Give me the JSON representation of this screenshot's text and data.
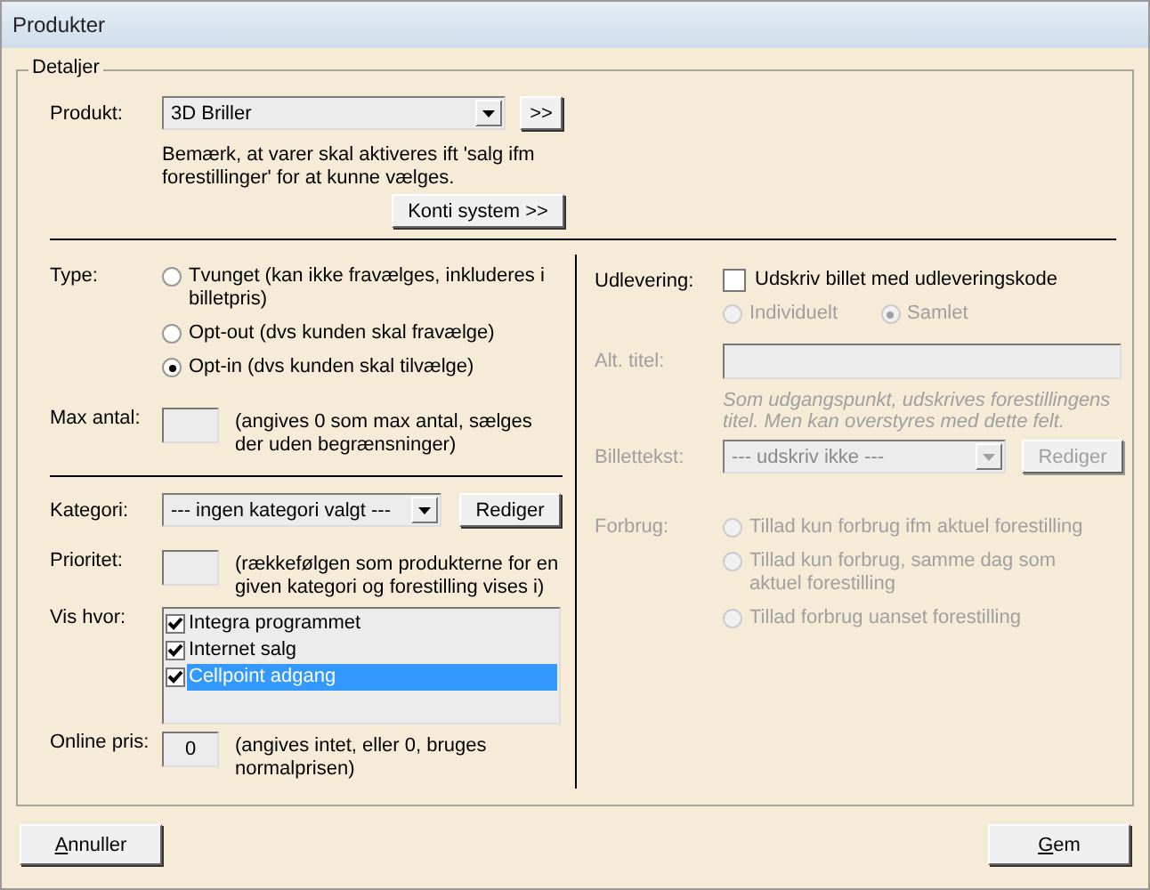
{
  "window": {
    "title": "Produkter"
  },
  "group": {
    "title": "Detaljer"
  },
  "product": {
    "label": "Produkt:",
    "value": "3D Briller",
    "more_button": ">>",
    "note": "Bemærk, at varer skal aktiveres ift 'salg ifm forestillinger' for at kunne vælges.",
    "konti_button": "Konti system >>"
  },
  "type": {
    "label": "Type:",
    "options": [
      {
        "label": "Tvunget (kan ikke fravælges, inkluderes i billetpris)",
        "selected": false
      },
      {
        "label": "Opt-out (dvs kunden skal fravælge)",
        "selected": false
      },
      {
        "label": "Opt-in (dvs kunden skal tilvælge)",
        "selected": true
      }
    ]
  },
  "max_antal": {
    "label": "Max antal:",
    "hint": "(angives 0 som max antal, sælges der uden begrænsninger)"
  },
  "kategori": {
    "label": "Kategori:",
    "value": "--- ingen kategori valgt ---",
    "button": "Rediger"
  },
  "prioritet": {
    "label": "Prioritet:",
    "hint": "(rækkefølgen som produkterne for en given kategori og forestilling vises i)"
  },
  "vis_hvor": {
    "label": "Vis hvor:",
    "items": [
      {
        "label": "Integra programmet",
        "checked": true,
        "selected": false
      },
      {
        "label": "Internet salg",
        "checked": true,
        "selected": false
      },
      {
        "label": "Cellpoint adgang",
        "checked": true,
        "selected": true
      }
    ]
  },
  "online_pris": {
    "label": "Online pris:",
    "value": "0",
    "hint": "(angives intet, eller 0, bruges normalprisen)"
  },
  "udlevering": {
    "label": "Udlevering:",
    "checkbox": {
      "label": "Udskriv billet med udleveringskode",
      "checked": false
    },
    "disabled": true,
    "options": [
      {
        "label": "Individuelt",
        "selected": false
      },
      {
        "label": "Samlet",
        "selected": true
      }
    ]
  },
  "alt_titel": {
    "label": "Alt. titel:",
    "note": "Som udgangspunkt, udskrives forestillingens titel. Men kan overstyres med dette felt.",
    "disabled": true
  },
  "billettekst": {
    "label": "Billettekst:",
    "value": "--- udskriv ikke ---",
    "button": "Rediger",
    "disabled": true
  },
  "forbrug": {
    "label": "Forbrug:",
    "disabled": true,
    "options": [
      {
        "label": "Tillad kun forbrug ifm aktuel forestilling",
        "selected": false
      },
      {
        "label": "Tillad kun forbrug, samme dag som aktuel forestilling",
        "selected": false
      },
      {
        "label": "Tillad forbrug uanset forestilling",
        "selected": false
      }
    ]
  },
  "buttons": [
    {
      "label": "Annuller"
    },
    {
      "label": "Gem"
    }
  ]
}
